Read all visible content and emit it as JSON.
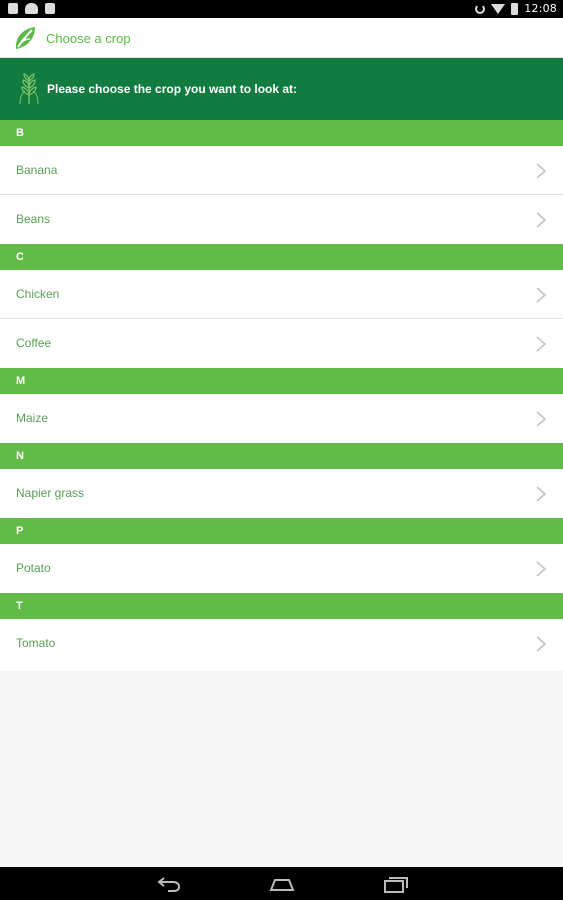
{
  "status_bar": {
    "time": "12:08",
    "icons": [
      "notification-icon",
      "cloud-icon",
      "briefcase-icon",
      "rotation-icon",
      "wifi-icon",
      "battery-icon"
    ]
  },
  "app_bar": {
    "title": "Choose a crop",
    "logo_icon": "leaf-logo-icon"
  },
  "banner": {
    "text": "Please choose the crop you want to look at:",
    "icon": "wheat-icon"
  },
  "sections": [
    {
      "letter": "B",
      "items": [
        "Banana",
        "Beans"
      ]
    },
    {
      "letter": "C",
      "items": [
        "Chicken",
        "Coffee"
      ]
    },
    {
      "letter": "M",
      "items": [
        "Maize"
      ]
    },
    {
      "letter": "N",
      "items": [
        "Napier grass"
      ]
    },
    {
      "letter": "P",
      "items": [
        "Potato"
      ]
    },
    {
      "letter": "T",
      "items": [
        "Tomato"
      ]
    }
  ],
  "nav_bar": {
    "icons": [
      "back-icon",
      "home-icon",
      "recent-apps-icon"
    ]
  },
  "colors": {
    "section_header": "#62bb47",
    "banner": "#117b40",
    "item_text": "#5a9e58",
    "title_text": "#5cb848"
  }
}
